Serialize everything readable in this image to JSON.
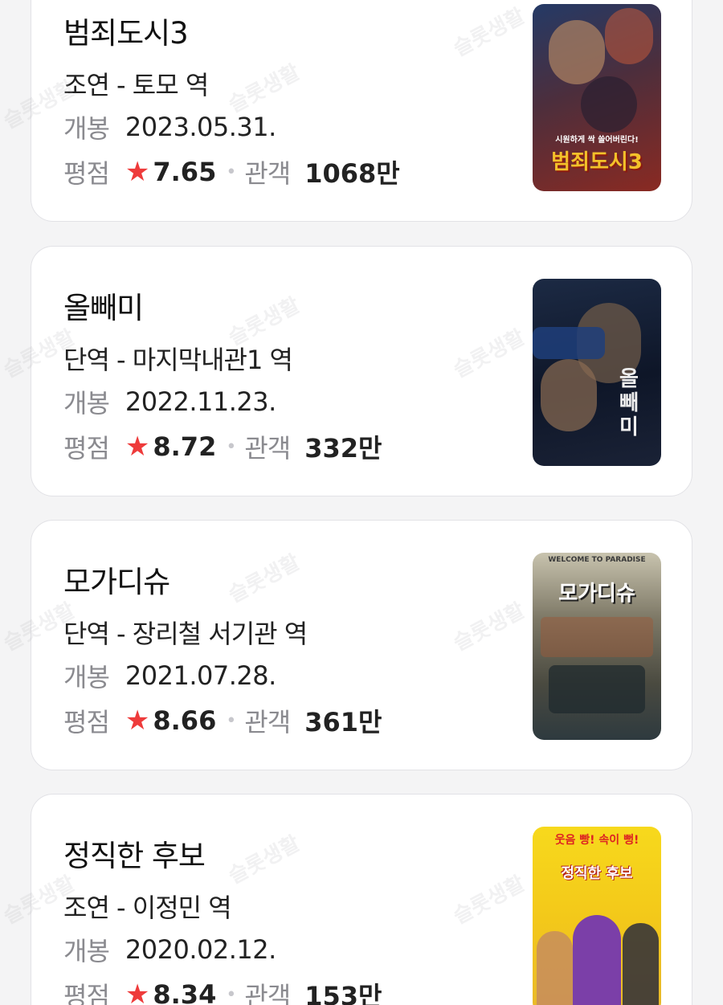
{
  "labels": {
    "release": "개봉",
    "rating": "평점",
    "audience": "관객",
    "star": "★",
    "dot": "•"
  },
  "watermark": "슬롯생활",
  "movies": [
    {
      "title": "범죄도시3",
      "role": "조연 - 토모 역",
      "release_date": "2023.05.31.",
      "rating": "7.65",
      "audience": "1068만",
      "poster_text": "범죄도시3",
      "poster_tagline": "시원하게 싹 쓸어버린다!",
      "poster_colors": [
        "#2c3e63",
        "#8a2a22"
      ]
    },
    {
      "title": "올빼미",
      "role": "단역 - 마지막내관1 역",
      "release_date": "2022.11.23.",
      "rating": "8.72",
      "audience": "332만",
      "poster_text": "올빼미",
      "poster_tagline": "",
      "poster_colors": [
        "#0f1a2e",
        "#3a4a6a"
      ]
    },
    {
      "title": "모가디슈",
      "role": "단역 - 장리철 서기관 역",
      "release_date": "2021.07.28.",
      "rating": "8.66",
      "audience": "361만",
      "poster_text": "모가디슈",
      "poster_tagline": "WELCOME TO PARADISE",
      "poster_colors": [
        "#6b6a5a",
        "#2e3a3f"
      ]
    },
    {
      "title": "정직한 후보",
      "role": "조연 - 이정민 역",
      "release_date": "2020.02.12.",
      "rating": "8.34",
      "audience": "153만",
      "poster_text": "정직한 후보",
      "poster_tagline": "웃음 빵! 속이 뻥!",
      "poster_colors": [
        "#f5d21c",
        "#7b3fa8"
      ]
    }
  ]
}
